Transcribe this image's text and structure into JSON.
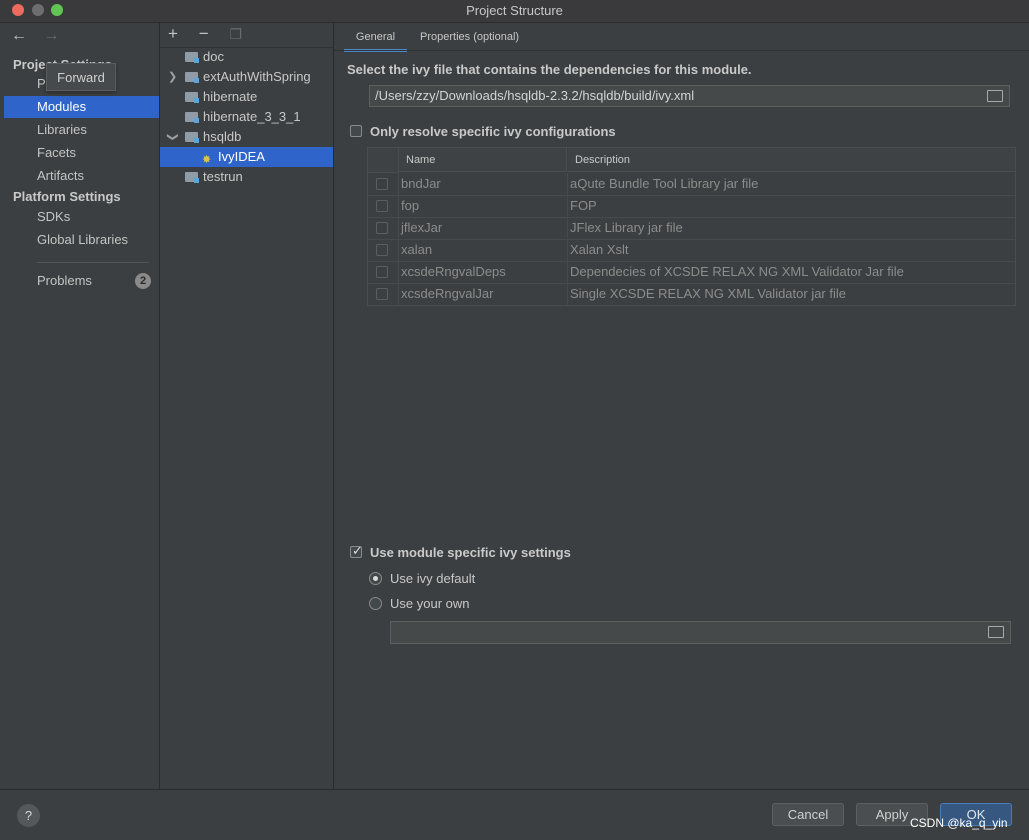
{
  "window": {
    "title": "Project Structure"
  },
  "sidebar": {
    "tooltip": "Forward",
    "project_settings_title": "Project Settings",
    "project_settings_items": [
      {
        "label": "Project"
      },
      {
        "label": "Modules",
        "selected": true
      },
      {
        "label": "Libraries"
      },
      {
        "label": "Facets"
      },
      {
        "label": "Artifacts"
      }
    ],
    "platform_settings_title": "Platform Settings",
    "platform_settings_items": [
      {
        "label": "SDKs"
      },
      {
        "label": "Global Libraries"
      }
    ],
    "problems": {
      "label": "Problems",
      "count": "2"
    }
  },
  "tree": {
    "toolbar": {
      "add": "+",
      "remove": "−"
    },
    "items": [
      {
        "label": "doc"
      },
      {
        "label": "extAuthWithSpring",
        "expandable": true
      },
      {
        "label": "hibernate"
      },
      {
        "label": "hibernate_3_3_1"
      },
      {
        "label": "hsqldb",
        "expanded": true
      },
      {
        "label": "IvyIDEA",
        "child": true,
        "selected": true
      },
      {
        "label": "testrun"
      }
    ]
  },
  "main": {
    "tabs": [
      {
        "label": "General",
        "active": true
      },
      {
        "label": "Properties (optional)"
      }
    ],
    "ivy_file_label": "Select the ivy file that contains the dependencies for this module.",
    "ivy_file_path": "/Users/zzy/Downloads/hsqldb-2.3.2/hsqldb/build/ivy.xml",
    "only_resolve_label": "Only resolve specific ivy configurations",
    "only_resolve_checked": false,
    "table": {
      "headers": {
        "name": "Name",
        "description": "Description"
      },
      "rows": [
        {
          "name": "bndJar",
          "description": "aQute Bundle Tool Library jar file"
        },
        {
          "name": "fop",
          "description": "FOP"
        },
        {
          "name": "jflexJar",
          "description": "JFlex Library jar file"
        },
        {
          "name": "xalan",
          "description": "Xalan Xslt"
        },
        {
          "name": "xcsdeRngvalDeps",
          "description": "Dependecies of XCSDE RELAX NG XML Validator Jar file"
        },
        {
          "name": "xcsdeRngvalJar",
          "description": "Single XCSDE RELAX NG XML Validator jar file"
        }
      ]
    },
    "module_settings_label": "Use module specific ivy settings",
    "module_settings_checked": true,
    "radio_default": "Use ivy default",
    "radio_own": "Use your own",
    "own_settings_path": ""
  },
  "bottom": {
    "help": "?",
    "cancel": "Cancel",
    "apply": "Apply",
    "ok": "OK",
    "watermark": "CSDN @ka_q_yin"
  }
}
